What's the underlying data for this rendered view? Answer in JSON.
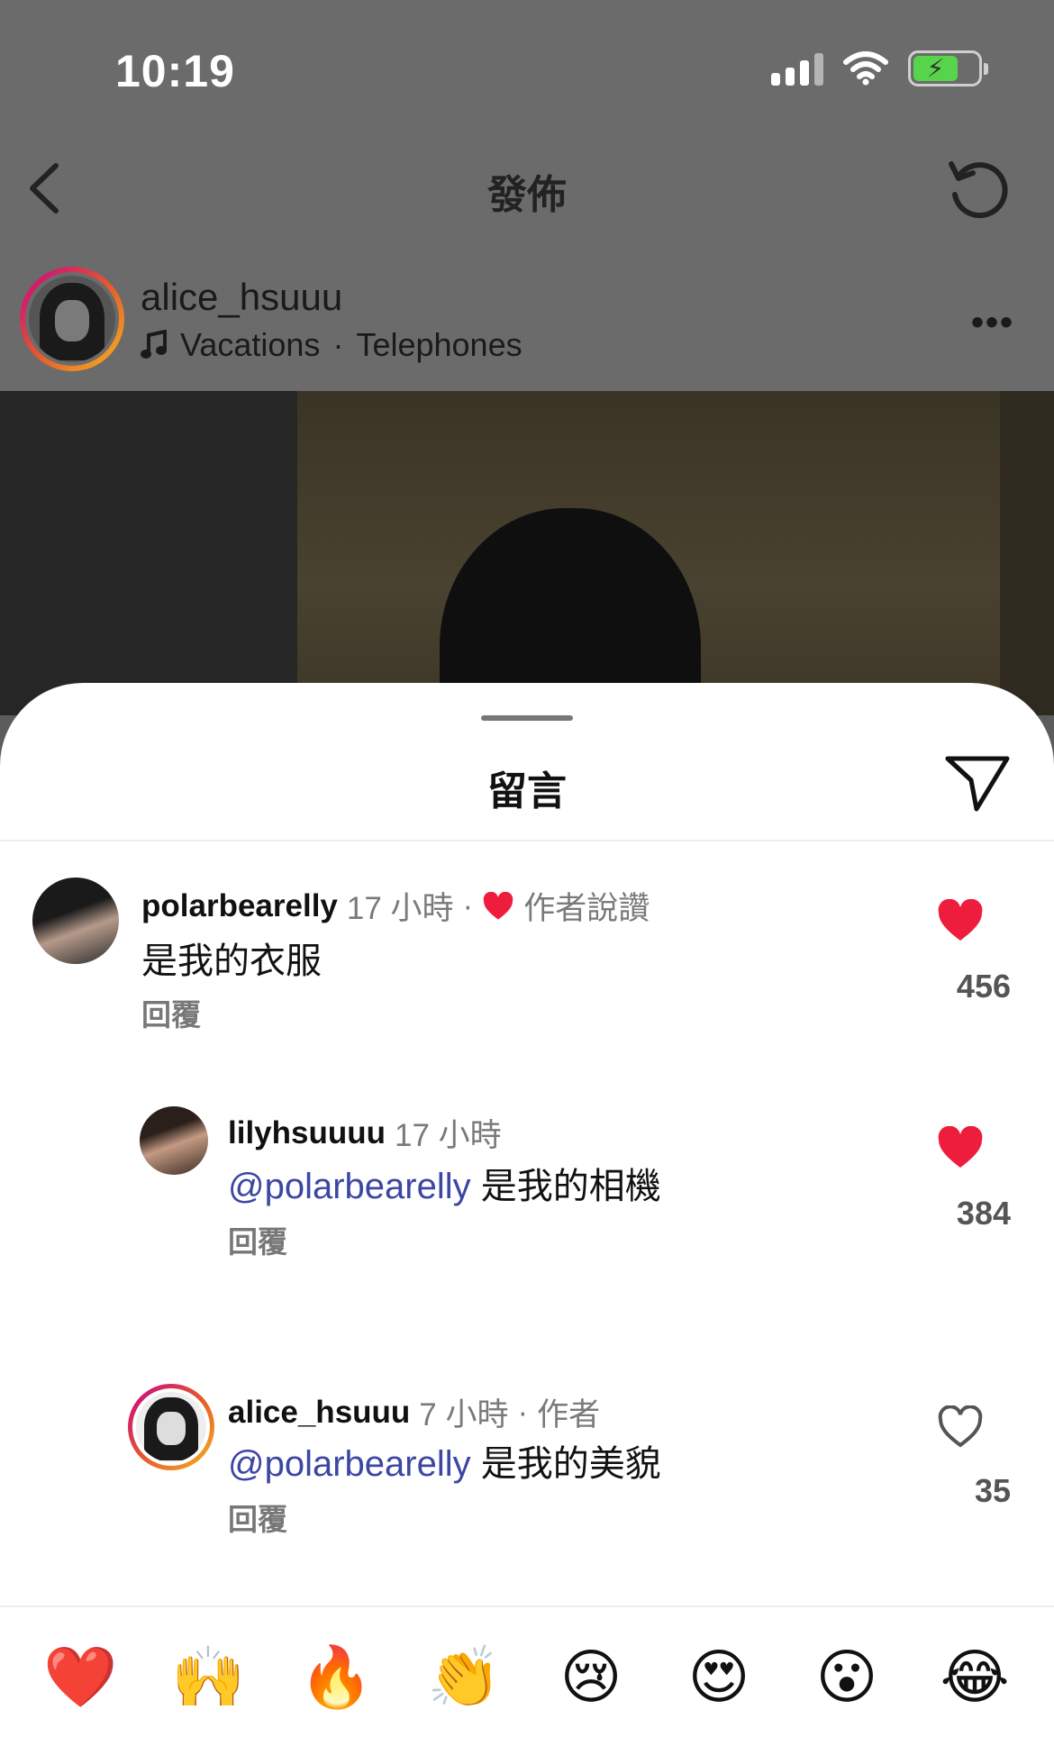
{
  "status_bar": {
    "time": "10:19"
  },
  "nav": {
    "title": "發佈"
  },
  "post": {
    "username": "alice_hsuuu",
    "song": "Vacations",
    "separator": "·",
    "artist": "Telephones",
    "more": "•••"
  },
  "sheet": {
    "title": "留言"
  },
  "comments": [
    {
      "username": "polarbearelly",
      "time": "17 小時",
      "separator": "·",
      "liked_by_author": "作者說讚",
      "text": "是我的衣服",
      "reply": "回覆",
      "likes": "456",
      "liked": true
    },
    {
      "username": "lilyhsuuuu",
      "time": "17 小時",
      "mention": "@polarbearelly",
      "text": "是我的相機",
      "reply": "回覆",
      "likes": "384",
      "liked": true
    },
    {
      "username": "alice_hsuuu",
      "time": "7 小時",
      "separator": "·",
      "author_badge": "作者",
      "mention": "@polarbearelly",
      "text": "是我的美貌",
      "reply": "回覆",
      "likes": "35",
      "liked": false
    }
  ],
  "emoji_bar": [
    "❤️",
    "🙌",
    "🔥",
    "👏",
    "😢",
    "😍",
    "😮",
    "😂"
  ],
  "colors": {
    "like_red": "#ee1d3d",
    "mention_blue": "#3c46a3",
    "battery_green": "#58d44c"
  }
}
